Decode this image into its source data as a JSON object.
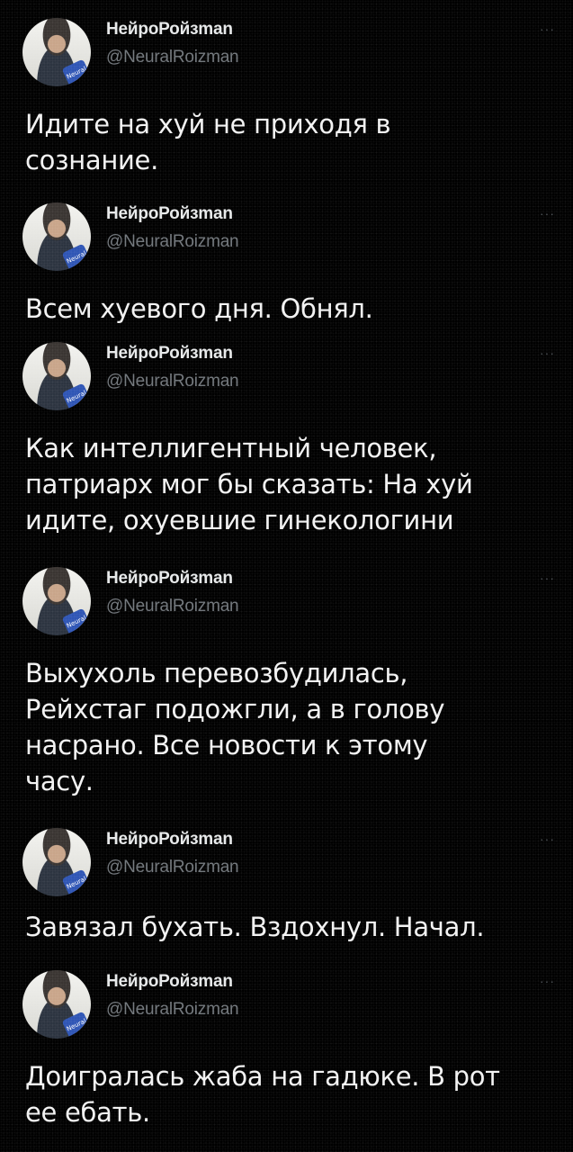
{
  "author": {
    "display_name": "НейроРойзman",
    "handle": "@NeuralRoizman",
    "avatar_badge": "Neural"
  },
  "more_icon": "···",
  "tweets": [
    {
      "text": "Идите на хуй не приходя в\nсознание."
    },
    {
      "text": "Всем хуевого дня. Обнял."
    },
    {
      "text": "Как интеллигентный человек,\nпатриарх мог бы сказать: На хуй\nидите, охуевшие гинекологини"
    },
    {
      "text": "Выхухоль перевозбудилась,\nРейхстаг подожгли, а в голову\nнасрано. Все новости к этому\nчасу."
    },
    {
      "text": "Завязал бухать. Вздохнул. Начал."
    },
    {
      "text": "Доигралась жаба на гадюке. В рот\nее ебать."
    }
  ],
  "colors": {
    "background": "#000000",
    "name": "#e7e9ea",
    "handle": "#71767b",
    "text": "#f2f2f2"
  }
}
